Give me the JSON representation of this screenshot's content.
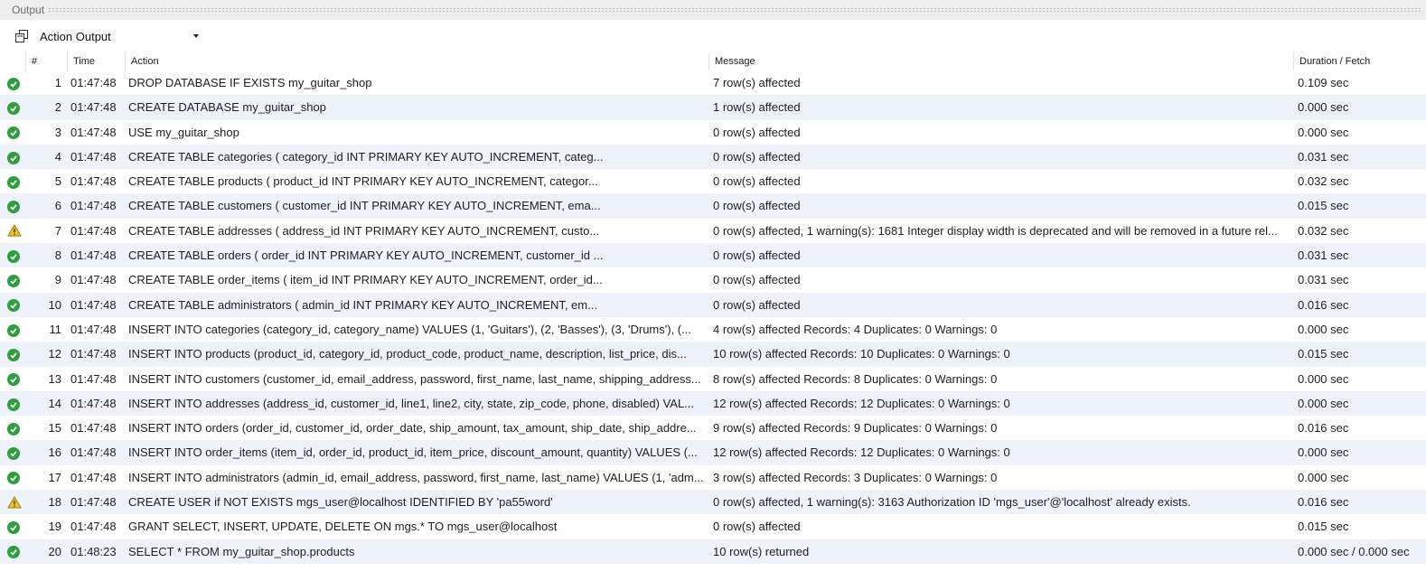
{
  "panel": {
    "title": "Output"
  },
  "toolbar": {
    "copy_icon": "copy-icon",
    "selected_option": "Action Output"
  },
  "colors": {
    "ok": "#2e9e3e",
    "warn_fill": "#f5c518",
    "warn_stroke": "#9a7a00",
    "row_alt": "#eef3fb"
  },
  "columns": {
    "num": "#",
    "time": "Time",
    "action": "Action",
    "message": "Message",
    "duration": "Duration / Fetch"
  },
  "rows": [
    {
      "status": "ok",
      "num": "1",
      "time": "01:47:48",
      "action": "DROP DATABASE IF EXISTS my_guitar_shop",
      "message": "7 row(s) affected",
      "duration": "0.109 sec"
    },
    {
      "status": "ok",
      "num": "2",
      "time": "01:47:48",
      "action": "CREATE DATABASE my_guitar_shop",
      "message": "1 row(s) affected",
      "duration": "0.000 sec"
    },
    {
      "status": "ok",
      "num": "3",
      "time": "01:47:48",
      "action": "USE my_guitar_shop",
      "message": "0 row(s) affected",
      "duration": "0.000 sec"
    },
    {
      "status": "ok",
      "num": "4",
      "time": "01:47:48",
      "action": "CREATE TABLE categories (   category_id       INT           PRIMARY KEY   AUTO_INCREMENT,   categ...",
      "message": "0 row(s) affected",
      "duration": "0.031 sec"
    },
    {
      "status": "ok",
      "num": "5",
      "time": "01:47:48",
      "action": "CREATE TABLE products (   product_id        INT           PRIMARY KEY   AUTO_INCREMENT,   categor...",
      "message": "0 row(s) affected",
      "duration": "0.032 sec"
    },
    {
      "status": "ok",
      "num": "6",
      "time": "01:47:48",
      "action": "CREATE TABLE customers (   customer_id          INT           PRIMARY KEY   AUTO_INCREMENT,   ema...",
      "message": "0 row(s) affected",
      "duration": "0.015 sec"
    },
    {
      "status": "warn",
      "num": "7",
      "time": "01:47:48",
      "action": "CREATE TABLE addresses (   address_id         INT           PRIMARY KEY   AUTO_INCREMENT,   custo...",
      "message": "0 row(s) affected, 1 warning(s): 1681 Integer display width is deprecated and will be removed in a future rel...",
      "duration": "0.032 sec"
    },
    {
      "status": "ok",
      "num": "8",
      "time": "01:47:48",
      "action": "CREATE TABLE orders (   order_id           INT           PRIMARY KEY  AUTO_INCREMENT,   customer_id ...",
      "message": "0 row(s) affected",
      "duration": "0.031 sec"
    },
    {
      "status": "ok",
      "num": "9",
      "time": "01:47:48",
      "action": "CREATE TABLE order_items (   item_id            INT           PRIMARY KEY   AUTO_INCREMENT,   order_id...",
      "message": "0 row(s) affected",
      "duration": "0.031 sec"
    },
    {
      "status": "ok",
      "num": "10",
      "time": "01:47:48",
      "action": "CREATE TABLE administrators (   admin_id           INT           PRIMARY KEY   AUTO_INCREMENT,   em...",
      "message": "0 row(s) affected",
      "duration": "0.016 sec"
    },
    {
      "status": "ok",
      "num": "11",
      "time": "01:47:48",
      "action": "INSERT INTO categories (category_id, category_name) VALUES (1, 'Guitars'), (2, 'Basses'), (3, 'Drums'),  (...",
      "message": "4 row(s) affected Records: 4  Duplicates: 0  Warnings: 0",
      "duration": "0.000 sec"
    },
    {
      "status": "ok",
      "num": "12",
      "time": "01:47:48",
      "action": "INSERT INTO products (product_id, category_id, product_code, product_name, description, list_price, dis...",
      "message": "10 row(s) affected Records: 10  Duplicates: 0  Warnings: 0",
      "duration": "0.015 sec"
    },
    {
      "status": "ok",
      "num": "13",
      "time": "01:47:48",
      "action": "INSERT INTO customers (customer_id, email_address, password, first_name, last_name, shipping_address...",
      "message": "8 row(s) affected Records: 8  Duplicates: 0  Warnings: 0",
      "duration": "0.000 sec"
    },
    {
      "status": "ok",
      "num": "14",
      "time": "01:47:48",
      "action": "INSERT INTO addresses (address_id, customer_id, line1, line2, city, state, zip_code, phone, disabled) VAL...",
      "message": "12 row(s) affected Records: 12  Duplicates: 0  Warnings: 0",
      "duration": "0.000 sec"
    },
    {
      "status": "ok",
      "num": "15",
      "time": "01:47:48",
      "action": "INSERT INTO orders (order_id, customer_id, order_date, ship_amount, tax_amount, ship_date, ship_addre...",
      "message": "9 row(s) affected Records: 9  Duplicates: 0  Warnings: 0",
      "duration": "0.016 sec"
    },
    {
      "status": "ok",
      "num": "16",
      "time": "01:47:48",
      "action": "INSERT INTO order_items (item_id, order_id, product_id, item_price, discount_amount, quantity) VALUES (...",
      "message": "12 row(s) affected Records: 12  Duplicates: 0  Warnings: 0",
      "duration": "0.000 sec"
    },
    {
      "status": "ok",
      "num": "17",
      "time": "01:47:48",
      "action": "INSERT INTO administrators (admin_id, email_address, password, first_name, last_name) VALUES (1, 'adm...",
      "message": "3 row(s) affected Records: 3  Duplicates: 0  Warnings: 0",
      "duration": "0.000 sec"
    },
    {
      "status": "warn",
      "num": "18",
      "time": "01:47:48",
      "action": "CREATE USER if NOT EXISTS mgs_user@localhost IDENTIFIED BY 'pa55word'",
      "message": "0 row(s) affected, 1 warning(s): 3163 Authorization ID 'mgs_user'@'localhost' already exists.",
      "duration": "0.016 sec"
    },
    {
      "status": "ok",
      "num": "19",
      "time": "01:47:48",
      "action": "GRANT SELECT, INSERT, UPDATE, DELETE ON mgs.* TO mgs_user@localhost",
      "message": "0 row(s) affected",
      "duration": "0.015 sec"
    },
    {
      "status": "ok",
      "num": "20",
      "time": "01:48:23",
      "action": "SELECT * FROM my_guitar_shop.products",
      "message": "10 row(s) returned",
      "duration": "0.000 sec / 0.000 sec"
    }
  ]
}
